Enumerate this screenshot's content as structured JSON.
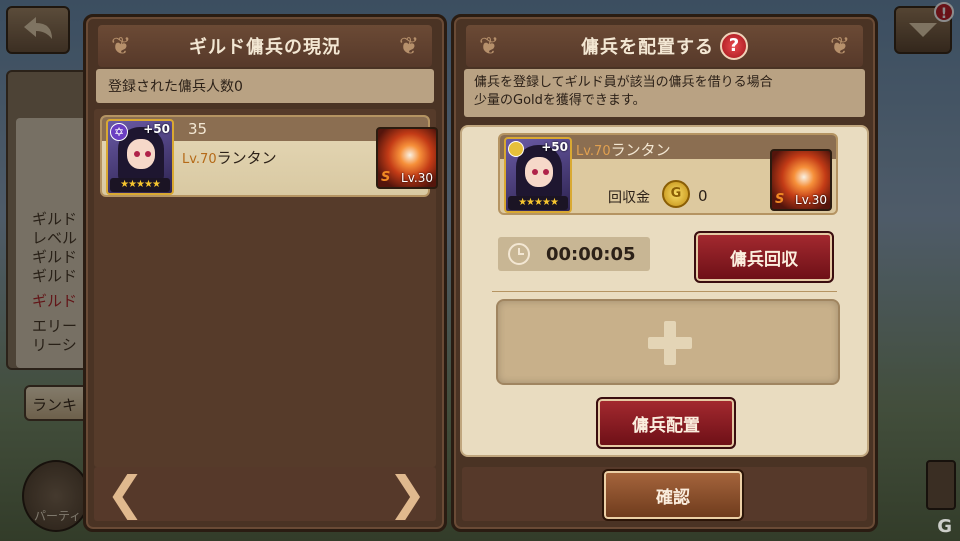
{
  "background": {
    "side_lines": [
      "ギルド",
      "レベル",
      "ギルド",
      "ギルド",
      "ギルド",
      "エリー",
      "リーシ"
    ],
    "ranking_label": "ランキ",
    "party_label": "パーティ",
    "alert_badge": "!"
  },
  "left_panel": {
    "title": "ギルド傭兵の現況",
    "registered_count": "登録された傭兵人数0",
    "mercenary": {
      "hp": "35",
      "bonus": "+50",
      "level": "Lv.70",
      "name": "ランタン",
      "stars": "★★★★★",
      "skill_rank": "S",
      "skill_level": "Lv.30"
    },
    "prev_arrow": "❮",
    "next_arrow": "❯"
  },
  "right_panel": {
    "title": "傭兵を配置する",
    "help": "?",
    "description_line1": "傭兵を登録してギルド員が該当の傭兵を借りる場合",
    "description_line2": "少量のGoldを獲得できます。",
    "deployed": {
      "bonus": "+50",
      "level": "Lv.70",
      "name": "ランタン",
      "stars": "★★★★★",
      "coin_label": "回収金",
      "coin_symbol": "G",
      "coin_value": "0",
      "skill_rank": "S",
      "skill_level": "Lv.30"
    },
    "timer": "00:00:05",
    "recall_button": "傭兵回収",
    "deploy_button": "傭兵配置",
    "confirm_button": "確認"
  },
  "watermark": "G"
}
